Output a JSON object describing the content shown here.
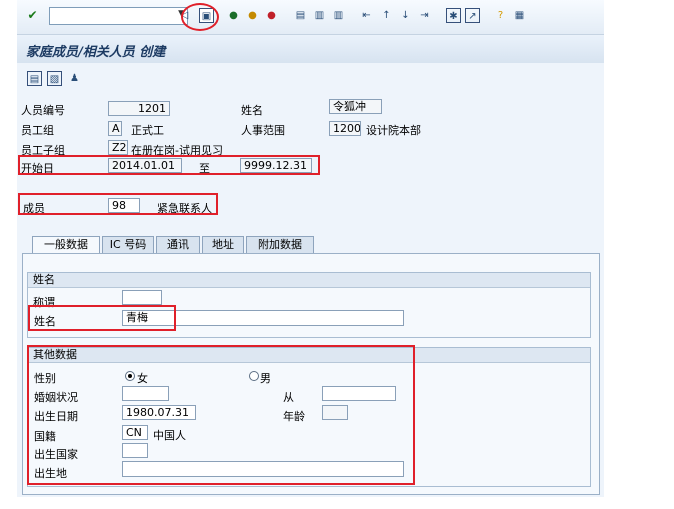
{
  "toolbar": {
    "icons": [
      "enter-icon",
      "back-icon",
      "save-icon",
      "back-arrow-icon",
      "exit-icon",
      "cancel-icon",
      "print-icon",
      "find-icon",
      "find-next-icon",
      "first-page-icon",
      "prev-page-icon",
      "next-page-icon",
      "last-page-icon",
      "new-session-icon",
      "shortcut-icon",
      "help-icon",
      "layout-icon"
    ],
    "command_field": ""
  },
  "title": "家庭成员/相关人员 创建",
  "header": {
    "pernr_label": "人员编号",
    "pernr_value": "1201",
    "name_label": "姓名",
    "name_value": "令狐冲",
    "group_label": "员工组",
    "group_code": "A",
    "group_text": "正式工",
    "area_label": "人事范围",
    "area_code": "1200",
    "area_text": "设计院本部",
    "subgroup_label": "员工子组",
    "subgroup_code": "Z2",
    "subgroup_text": "在册在岗-试用见习",
    "start_label": "开始日",
    "start_value": "2014.01.01",
    "to_label": "至",
    "end_value": "9999.12.31",
    "member_label": "成员",
    "member_code": "98",
    "member_text": "紧急联系人"
  },
  "tabs": [
    "一般数据",
    "IC 号码",
    "通讯",
    "地址",
    "附加数据"
  ],
  "name_group": {
    "title": "姓名",
    "salutation_label": "称谓",
    "salutation_value": "",
    "name_label": "姓名",
    "name_value": "青梅"
  },
  "other_group": {
    "title": "其他数据",
    "gender_label": "性别",
    "female": "女",
    "male": "男",
    "gender_selected": "female",
    "marital_label": "婚姻状况",
    "marital_value": "",
    "since_label": "从",
    "since_value": "",
    "birth_label": "出生日期",
    "birth_value": "1980.07.31",
    "age_label": "年龄",
    "age_value": "",
    "nation_label": "国籍",
    "nation_code": "CN",
    "nation_text": "中国人",
    "birth_country_label": "出生国家",
    "birth_country_value": "",
    "birth_place_label": "出生地",
    "birth_place_value": ""
  },
  "colors": {
    "highlight": "#e0202a",
    "title_text": "#1d3b63"
  }
}
